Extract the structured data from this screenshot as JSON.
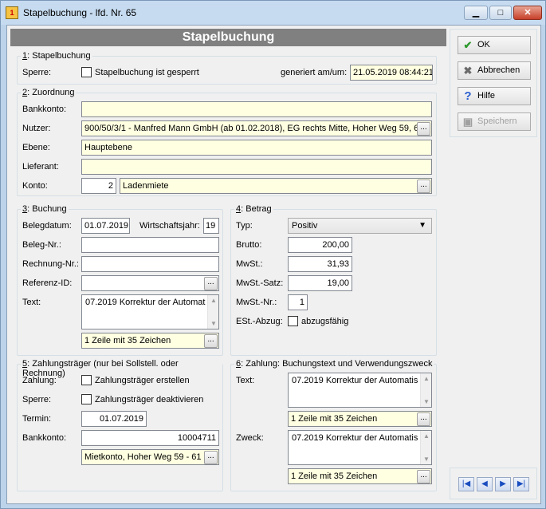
{
  "window": {
    "title": "Stapelbuchung - lfd. Nr. 65",
    "min_glyph": "▁",
    "max_glyph": "□",
    "close_glyph": "✕",
    "app_icon_text": "1"
  },
  "header": "Stapelbuchung",
  "section1": {
    "num": "1",
    "title": ": Stapelbuchung",
    "sperre_label": "Sperre:",
    "gesperrt_label": "Stapelbuchung ist gesperrt",
    "gesperrt_checked": false,
    "generiert_label": "generiert am/um:",
    "generiert_value": "21.05.2019 08:44:21"
  },
  "section2": {
    "num": "2",
    "title": ": Zuordnung",
    "bankkonto_label": "Bankkonto:",
    "bankkonto_value": "",
    "nutzer_label": "Nutzer:",
    "nutzer_value": "900/50/3/1 - Manfred Mann GmbH  (ab 01.02.2018), EG rechts Mitte, Hoher Weg 59, 6",
    "ebene_label": "Ebene:",
    "ebene_value": "Hauptebene",
    "lieferant_label": "Lieferant:",
    "lieferant_value": "",
    "konto_label": "Konto:",
    "konto_num": "2",
    "konto_name": "Ladenmiete"
  },
  "section3": {
    "num": "3",
    "title": ": Buchung",
    "belegdatum_label": "Belegdatum:",
    "belegdatum_value": "01.07.2019",
    "wirtschaftsjahr_label": "Wirtschaftsjahr:",
    "wirtschaftsjahr_value": "19",
    "belegnr_label": "Beleg-Nr.:",
    "belegnr_value": "",
    "rechnungnr_label": "Rechnung-Nr.:",
    "rechnungnr_value": "",
    "referenz_label": "Referenz-ID:",
    "referenz_value": "",
    "text_label": "Text:",
    "text_value": "07.2019 Korrektur der Automat",
    "text_info": "1 Zeile mit 35 Zeichen"
  },
  "section4": {
    "num": "4",
    "title": ": Betrag",
    "typ_label": "Typ:",
    "typ_value": "Positiv",
    "brutto_label": "Brutto:",
    "brutto_value": "200,00",
    "mwst_label": "MwSt.:",
    "mwst_value": "31,93",
    "mwstsatz_label": "MwSt.-Satz:",
    "mwstsatz_value": "19,00",
    "mwstnr_label": "MwSt.-Nr.:",
    "mwstnr_value": "1",
    "est_label": "ESt.-Abzug:",
    "abzug_label": "abzugsfähig",
    "abzug_checked": false
  },
  "section5": {
    "num": "5",
    "title": ": Zahlungsträger (nur bei Sollstell. oder Rechnung)",
    "zahlung_label": "Zahlung:",
    "erstellen_label": "Zahlungsträger erstellen",
    "sperre_label": "Sperre:",
    "deaktivieren_label": "Zahlungsträger deaktivieren",
    "termin_label": "Termin:",
    "termin_value": "01.07.2019",
    "bankkonto_label": "Bankkonto:",
    "bankkonto_value": "10004711",
    "bankkonto_name": "Mietkonto,  Hoher Weg 59 - 61"
  },
  "section6": {
    "num": "6",
    "title": ": Zahlung: Buchungstext und Verwendungszweck",
    "text_label": "Text:",
    "text_value": "07.2019 Korrektur der Automatis",
    "text_info": "1 Zeile mit 35 Zeichen",
    "zweck_label": "Zweck:",
    "zweck_value": "07.2019 Korrektur der Automatis",
    "zweck_info": "1 Zeile mit 35 Zeichen"
  },
  "actions": {
    "ok": "OK",
    "abbrechen": "Abbrechen",
    "hilfe": "Hilfe",
    "speichern": "Speichern",
    "ok_icon": "✔",
    "abbrechen_icon": "✖",
    "hilfe_icon": "?",
    "speichern_icon": "▣"
  },
  "nav": {
    "first": "|◀",
    "prev": "◀",
    "next": "▶",
    "last": "▶|"
  },
  "ellipsis": "...",
  "colors": {
    "header_bg": "#808080",
    "field_yellow": "#ffffe1",
    "ok_green": "#2f9a2f",
    "cancel_gray": "#6a6a6a",
    "help_blue": "#2a5fd0",
    "nav_blue": "#1a4dbf"
  }
}
